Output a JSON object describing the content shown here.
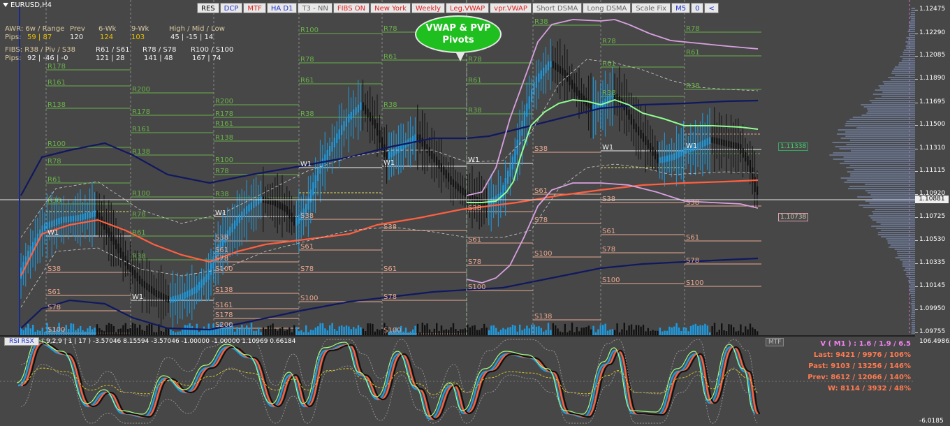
{
  "window": {
    "symbol": "EURUSD,H4"
  },
  "toolbar": [
    {
      "label": "RES",
      "c": ""
    },
    {
      "label": "DCP",
      "c": "c-blue"
    },
    {
      "label": "MTF",
      "c": "c-red"
    },
    {
      "label": "HA D1",
      "c": "c-blue"
    },
    {
      "label": "T3 - NN",
      "c": "c-grey"
    },
    {
      "label": "FIBS ON",
      "c": "c-red"
    },
    {
      "label": "New York",
      "c": "c-red"
    },
    {
      "label": "Weekly",
      "c": "c-red"
    },
    {
      "label": "Leg.VWAP",
      "c": "c-red"
    },
    {
      "label": "vpr.VWAP",
      "c": "c-red"
    },
    {
      "label": "Short DSMA",
      "c": "c-grey"
    },
    {
      "label": "Long DSMA",
      "c": "c-grey"
    },
    {
      "label": "Scale Fix",
      "c": "c-grey"
    },
    {
      "label": "M5",
      "c": "c-blue"
    },
    {
      "label": "0",
      "c": "c-blue"
    },
    {
      "label": "<",
      "c": "c-blue"
    }
  ],
  "info": {
    "awr_label": "AWR: 6w / Range",
    "prev_label": "Prev",
    "wk6_label": "6-Wk",
    "wk9_label": "9-Wk",
    "hml_label": "High / Mid / Low",
    "pips_label": "Pips:",
    "awr_val": "59 | 87",
    "prev_val": "120",
    "wk6_val": "124",
    "wk9_val": "103",
    "hml_val": "45  | -15  | 14",
    "fibs_label": "FIBS: R38 / Piv / S38",
    "r61_label": "R61 / S61",
    "r78_label": "R78 / S78",
    "r100_label": "R100 / S100",
    "fibs_val": "92  | -46  | -0",
    "r61_val": "121 | 28",
    "r78_val": "141 | 48",
    "r100_val": "167 | 74"
  },
  "callout": {
    "line1": "VWAP & PVP",
    "line2": "Pivots"
  },
  "price_axis": {
    "ticks": [
      "1.12475",
      "1.12290",
      "1.12085",
      "1.11890",
      "1.11695",
      "1.11500",
      "1.11310",
      "1.11115",
      "1.10920",
      "1.10725",
      "1.10530",
      "1.10335",
      "1.10145",
      "1.09950",
      "1.09755"
    ],
    "current": "1.10881",
    "osc_top": "106.49862",
    "osc_bottom": "-6.0185"
  },
  "price_boxes": {
    "vwap": "1.10738",
    "pvp": "1.11338"
  },
  "oscillator": {
    "button": "RSI RSX",
    "params": "( 9,2,9 | 1 | 17 ) -3.57046 8.15594 -3.57046 -1.00000 -1.00000 1.10969 0.66184",
    "mtf": "MTF"
  },
  "vstats": {
    "v": "V ( M1 ) : 1.6 / 1.9 / 6.5",
    "last": "Last: 9421 / 9976 / 106%",
    "past": "Past: 9103 / 13256 / 146%",
    "prev": "Prev: 8612 / 12066 / 140%",
    "w": "W: 8114 / 3932 / 48%"
  },
  "levels": {
    "R178": "R178",
    "R161": "R161",
    "R138": "R138",
    "R100": "R100",
    "R78": "R78",
    "R61": "R61",
    "R38": "R38",
    "S38": "S38",
    "S61": "S61",
    "S78": "S78",
    "S100": "S100",
    "S138": "S138",
    "S161": "S161",
    "S178": "S178",
    "S200": "S200",
    "R200": "R200",
    "W1": "W1"
  },
  "colors": {
    "bg": "#474747",
    "bull": "#1e9be0",
    "bear": "#111111",
    "res": "#6ab04a",
    "sup": "#e8a890",
    "vwap": "#101860",
    "red": "#ff6040",
    "green": "#90ff90",
    "purple": "#d8a0e0"
  }
}
